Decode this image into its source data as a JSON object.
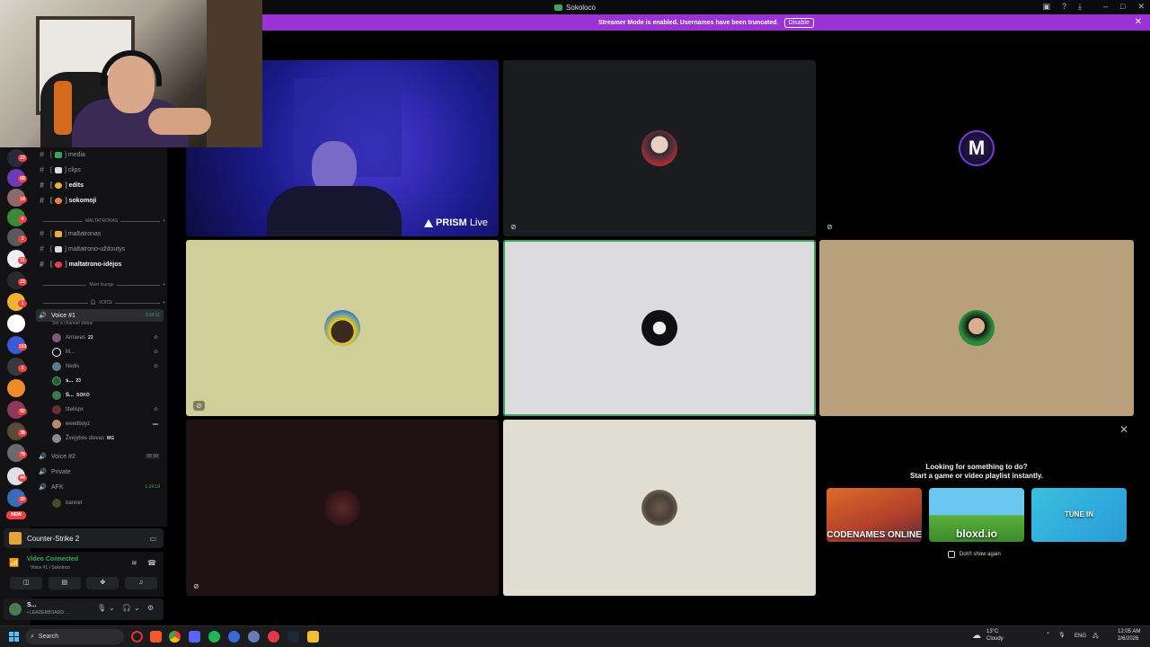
{
  "window": {
    "title": "Sokoloco"
  },
  "banner": {
    "text": "Streamer Mode is enabled. Usernames have been truncated.",
    "disable_label": "Disable"
  },
  "channels": [
    {
      "name": "media",
      "bright": false,
      "color": "#3ba55d"
    },
    {
      "name": "clips",
      "bright": false,
      "color": "#dbdee1"
    },
    {
      "name": "edits",
      "bright": true,
      "color": "#f0b232"
    },
    {
      "name": "sokomoji",
      "bright": true,
      "color": "#e8824a"
    }
  ],
  "category_maltatronas": "MALTATRONAS",
  "channels2": [
    {
      "name": "maltatronas",
      "bright": false,
      "color": "#f0b232"
    },
    {
      "name": "maltatrono-uždoutys",
      "bright": false,
      "color": "#dbdee1"
    },
    {
      "name": "maltatrono-idėjos",
      "bright": true,
      "color": "#f23f43"
    }
  ],
  "category_lounge": "Main lounge",
  "category_voice": "VOICE",
  "voice1": {
    "name": "Voice #1",
    "timer": "3:34:11",
    "status": "Set a channel status"
  },
  "members": [
    {
      "name": "Arnaxas",
      "tag": "23",
      "avatar": "#7a5c7a",
      "bold": false
    },
    {
      "name": "M...",
      "tag": "",
      "avatar": "#111111",
      "bold": false
    },
    {
      "name": "Nedis",
      "tag": "",
      "avatar": "#5c7a8a",
      "bold": false
    },
    {
      "name": "s...",
      "tag": "23",
      "avatar": "#2e5a3a",
      "bold": true
    },
    {
      "name": "S...",
      "tag": "SOKO",
      "avatar": "#3b7a4e",
      "bold": true
    },
    {
      "name": "titelispx",
      "tag": "",
      "avatar": "#6a3030",
      "bold": false
    },
    {
      "name": "weedboyz",
      "tag": "",
      "avatar": "#b58a6a",
      "bold": false
    },
    {
      "name": "Žvejybos dievas",
      "tag": "MG",
      "avatar": "#8a8a8a",
      "bold": false
    }
  ],
  "voice2": {
    "name": "Voice #2",
    "count": "00 99"
  },
  "private_ch": {
    "name": "Private"
  },
  "afk": {
    "name": "AFK",
    "timer": "1:24:19",
    "member": "bannet"
  },
  "game": {
    "name": "Counter-Strike 2"
  },
  "connection": {
    "status": "Video Connected",
    "sub": "Voice #1 / Sokoloco"
  },
  "user": {
    "name": "S...",
    "status": "• LEADERBOARD: ..."
  },
  "tiles": {
    "prism_brand": "PRISM",
    "prism_live": "Live"
  },
  "activity": {
    "heading1": "Looking for something to do?",
    "heading2": "Start a game or video playlist instantly.",
    "games": [
      "CODENAMES ONLINE",
      "bloxd.io",
      "TUNE IN"
    ],
    "dont_show": "Don't show again"
  },
  "taskbar": {
    "search": "Search",
    "weather_temp": "13°C",
    "weather_desc": "Cloudy",
    "lang": "ENG",
    "time": "12:05 AM",
    "date": "2/6/2026"
  },
  "server_badges": [
    "23",
    "68",
    "18",
    "4",
    "3",
    "11",
    "23",
    "1",
    "163",
    "3",
    "92",
    "38",
    "78",
    "44",
    "20"
  ],
  "new_badge": "NEW"
}
